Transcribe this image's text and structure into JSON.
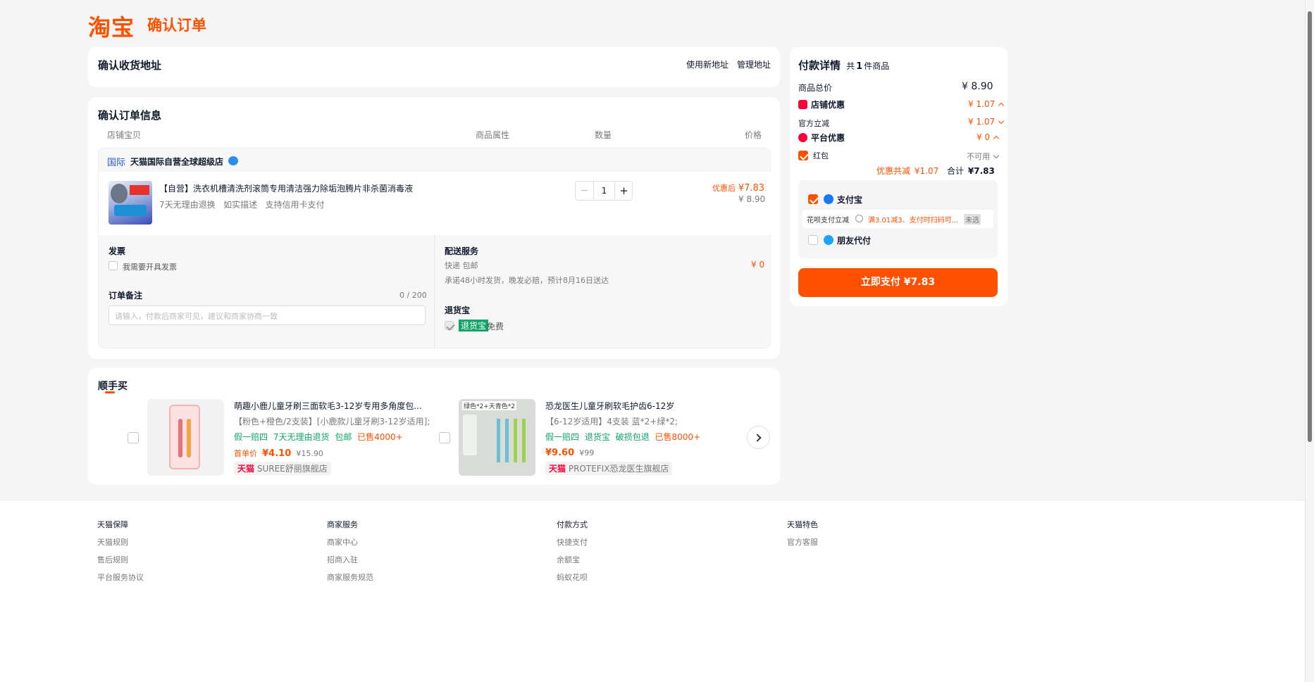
{
  "header": {
    "logo": "淘宝",
    "title": "确认订单"
  },
  "address": {
    "title": "确认收货地址",
    "new_address": "使用新地址",
    "manage_address": "管理地址"
  },
  "order": {
    "title": "确认订单信息",
    "columns": [
      "店铺宝贝",
      "商品属性",
      "数量",
      "价格"
    ],
    "store": {
      "badge": "国际",
      "name": "天猫国际自营全球超级店"
    },
    "item": {
      "name": "【自营】洗衣机槽清洗剂滚筒专用清洁强力除垢泡腾片非杀菌消毒液",
      "tags": "7天无理由退换   如实描述   支持信用卡支付",
      "quantity": "1",
      "decrease": "−",
      "increase": "+",
      "discount_label": "优惠后",
      "discount_price": "¥7.83",
      "original_price": "¥ 8.90",
      "thumb_text": "去污除垢 强效除菌"
    },
    "invoice": {
      "title": "发票",
      "option": "我需要开具发票"
    },
    "note": {
      "title": "订单备注",
      "counter": "0 / 200",
      "placeholder": "请输入，付款后商家可见，建议和商家协商一致"
    },
    "delivery": {
      "title": "配送服务",
      "method": "快递 包邮",
      "price": "¥ 0",
      "promise": "承诺48小时发货，晚发必赔，预计8月16日送达"
    },
    "return": {
      "title": "退货宝",
      "badge": "退货宝",
      "free": "免费"
    }
  },
  "recommend": {
    "title": "顺手买",
    "items": [
      {
        "title": "萌趣小鹿儿童牙刷三面软毛3-12岁专用多角度包...",
        "spec": "【粉色+橙色/2支装】[小鹿款儿童牙刷3-12岁适用];",
        "tags": [
          "假一赔四",
          "7天无理由退货",
          "包邮",
          "已售4000+"
        ],
        "price_label": "首单价",
        "price": "¥4.10",
        "old_price": "¥15.90",
        "store_badge": "天猫",
        "store": "SUREE舒丽旗舰店"
      },
      {
        "title": "恐龙医生儿童牙刷软毛护齿6-12岁",
        "spec": "【6-12岁适用】4支装 蓝*2+绿*2;",
        "tags": [
          "假一赔四",
          "退货宝",
          "破损包退",
          "已售8000+"
        ],
        "price_label": "",
        "price": "¥9.60",
        "old_price": "¥99",
        "store_badge": "天猫",
        "store": "PROTEFIX恐龙医生旗舰店",
        "thumb_text": "绿色*2+天青色*2"
      }
    ]
  },
  "payment": {
    "title": "付款详情",
    "count_prefix": "共",
    "count": "1",
    "count_suffix": "件商品",
    "total_label": "商品总价",
    "total": "¥ 8.90",
    "shop_discount_label": "店铺优惠",
    "shop_discount": "¥ 1.07",
    "official_label": "官方立减",
    "official": "¥ 1.07",
    "platform_label": "平台优惠",
    "platform": "¥ 0",
    "redpacket_label": "红包",
    "redpacket_status": "不可用",
    "saving_label": "优惠共减",
    "saving": "¥1.07",
    "sum_label": "合计",
    "sum": "¥7.83",
    "alipay": "支付宝",
    "huabei_label": "花呗支付立减",
    "huabei_offer": "满3.01减3、支付时扫码可...",
    "huabei_status": "未选",
    "friend_pay": "朋友代付",
    "pay_button": "立即支付 ¥7.83"
  },
  "footer": {
    "columns": [
      {
        "title": "天猫保障",
        "links": [
          "天猫规则",
          "售后规则",
          "平台服务协议"
        ]
      },
      {
        "title": "商家服务",
        "links": [
          "商家中心",
          "招商入驻",
          "商家服务规范"
        ]
      },
      {
        "title": "付款方式",
        "links": [
          "快捷支付",
          "余额宝",
          "蚂蚁花呗"
        ]
      },
      {
        "title": "天猫特色",
        "links": [
          "官方客服"
        ]
      }
    ]
  },
  "colors": {
    "accent": "#ff5000",
    "green": "#12a56a",
    "page_bg": "#f5f5f5"
  }
}
